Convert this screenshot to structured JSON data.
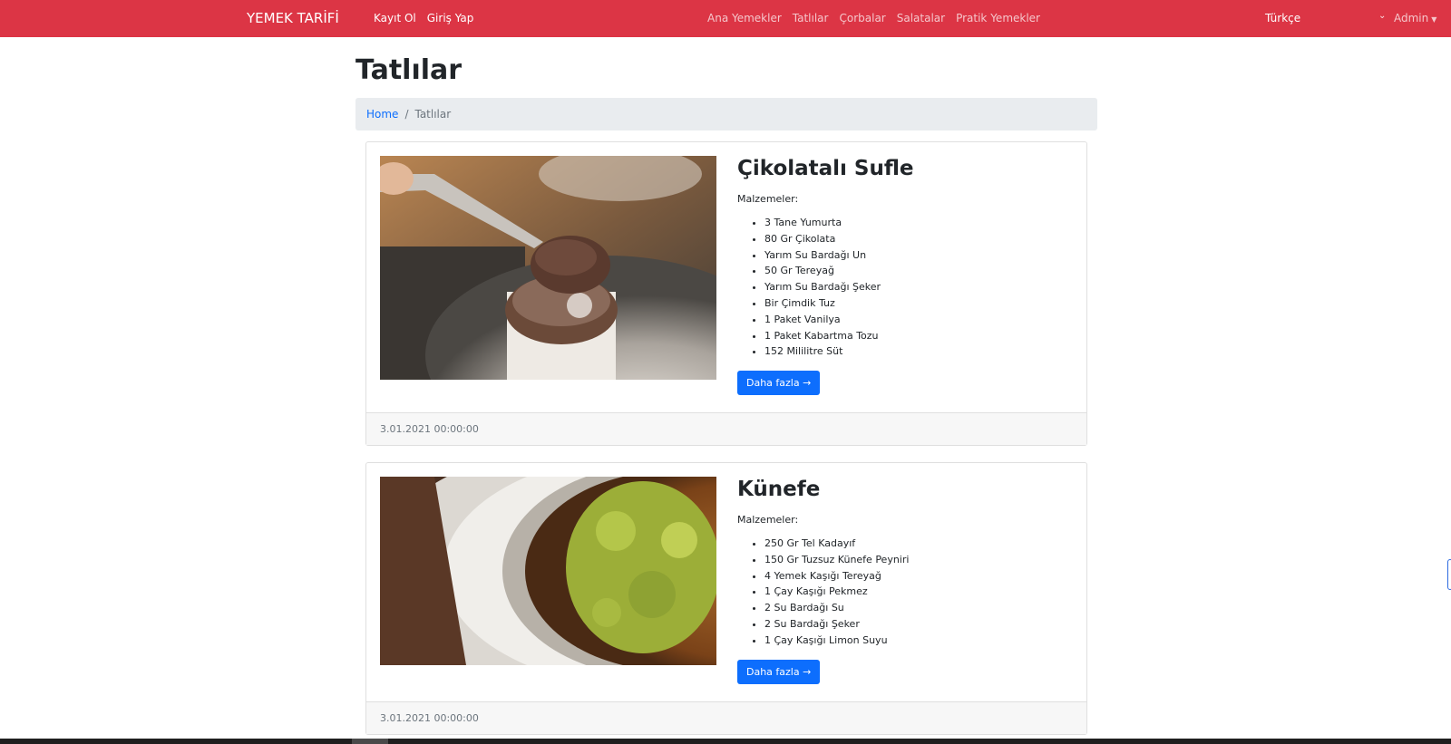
{
  "navbar": {
    "brand": "YEMEK TARİFİ",
    "auth_links": [
      "Kayıt Ol",
      "Giriş Yap"
    ],
    "category_links": [
      "Ana Yemekler",
      "Tatlılar",
      "Çorbalar",
      "Salatalar",
      "Pratik Yemekler"
    ],
    "language": "Türkçe",
    "user": "Admin",
    "color": "#dc3545"
  },
  "page": {
    "title": "Tatlılar",
    "breadcrumb": {
      "home": "Home",
      "separator": "/",
      "current": "Tatlılar"
    }
  },
  "recipes": [
    {
      "title": "Çikolatalı Sufle",
      "ingredients_label": "Malzemeler:",
      "ingredients": [
        "3 Tane Yumurta",
        "80 Gr Çikolata",
        "Yarım Su Bardağı Un",
        "50 Gr Tereyağ",
        "Yarım Su Bardağı Şeker",
        "Bir Çimdik Tuz",
        "1 Paket Vanilya",
        "1 Paket Kabartma Tozu",
        "152 Mililitre Süt"
      ],
      "button": "Daha fazla →",
      "date": "3.01.2021 00:00:00"
    },
    {
      "title": "Künefe",
      "ingredients_label": "Malzemeler:",
      "ingredients": [
        "250 Gr Tel Kadayıf",
        "150 Gr Tuzsuz Künefe Peyniri",
        "4 Yemek Kaşığı Tereyağ",
        "1 Çay Kaşığı Pekmez",
        "2 Su Bardağı Su",
        "2 Su Bardağı Şeker",
        "1 Çay Kaşığı Limon Suyu"
      ],
      "button": "Daha fazla →",
      "date": "3.01.2021 00:00:00"
    }
  ],
  "colors": {
    "accent": "#dc3545",
    "primary_button": "#0d6efd",
    "breadcrumb_bg": "#e9ecef"
  }
}
